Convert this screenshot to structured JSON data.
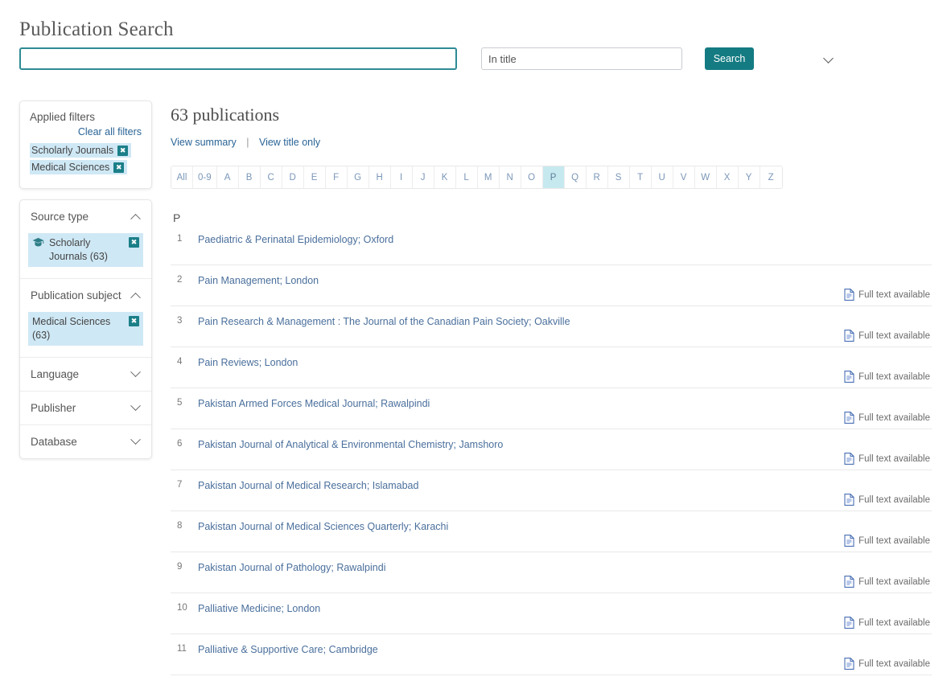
{
  "page": {
    "title": "Publication Search"
  },
  "search": {
    "query_value": "",
    "query_placeholder": "",
    "scope_selected": "In title",
    "scope_options": [
      "In title"
    ],
    "search_button": "Search",
    "dropdown_icon": "chevron-down-icon"
  },
  "applied_filters": {
    "heading": "Applied filters",
    "clear_all": "Clear all filters",
    "chips": [
      {
        "label": "Scholarly Journals",
        "remove_icon": "close-icon"
      },
      {
        "label": "Medical Sciences",
        "remove_icon": "close-icon"
      }
    ]
  },
  "facets": [
    {
      "name": "Source type",
      "expanded": true,
      "toggle_icon": "chevron-up-icon",
      "items": [
        {
          "label": "Scholarly Journals (63)",
          "icon": "graduation-cap-icon",
          "remove_icon": "close-icon"
        }
      ]
    },
    {
      "name": "Publication subject",
      "expanded": true,
      "toggle_icon": "chevron-up-icon",
      "items": [
        {
          "label": "Medical Sciences (63)",
          "icon": "",
          "remove_icon": "close-icon"
        }
      ]
    },
    {
      "name": "Language",
      "expanded": false,
      "toggle_icon": "chevron-down-icon",
      "items": []
    },
    {
      "name": "Publisher",
      "expanded": false,
      "toggle_icon": "chevron-down-icon",
      "items": []
    },
    {
      "name": "Database",
      "expanded": false,
      "toggle_icon": "chevron-down-icon",
      "items": []
    }
  ],
  "results": {
    "count_label": "63 publications",
    "view_summary": "View summary",
    "view_separator": "|",
    "view_title_only": "View title only",
    "alphabet": [
      "All",
      "0-9",
      "A",
      "B",
      "C",
      "D",
      "E",
      "F",
      "G",
      "H",
      "I",
      "J",
      "K",
      "L",
      "M",
      "N",
      "O",
      "P",
      "Q",
      "R",
      "S",
      "T",
      "U",
      "V",
      "W",
      "X",
      "Y",
      "Z"
    ],
    "alphabet_active": "P",
    "group_letter": "P",
    "full_text_label": "Full text available",
    "full_text_icon": "document-icon",
    "items": [
      {
        "num": "1",
        "title": "Paediatric & Perinatal Epidemiology; Oxford",
        "full_text": false
      },
      {
        "num": "2",
        "title": "Pain Management; London",
        "full_text": true
      },
      {
        "num": "3",
        "title": "Pain Research & Management : The Journal of the Canadian Pain Society; Oakville",
        "full_text": true
      },
      {
        "num": "4",
        "title": "Pain Reviews; London",
        "full_text": true
      },
      {
        "num": "5",
        "title": "Pakistan Armed Forces Medical Journal; Rawalpindi",
        "full_text": true
      },
      {
        "num": "6",
        "title": "Pakistan Journal of Analytical & Environmental Chemistry; Jamshoro",
        "full_text": true
      },
      {
        "num": "7",
        "title": "Pakistan Journal of Medical Research; Islamabad",
        "full_text": true
      },
      {
        "num": "8",
        "title": "Pakistan Journal of Medical Sciences Quarterly; Karachi",
        "full_text": true
      },
      {
        "num": "9",
        "title": "Pakistan Journal of Pathology; Rawalpindi",
        "full_text": true
      },
      {
        "num": "10",
        "title": "Palliative Medicine; London",
        "full_text": true
      },
      {
        "num": "11",
        "title": "Palliative & Supportive Care; Cambridge",
        "full_text": true
      }
    ]
  },
  "colors": {
    "teal": "#147b82",
    "chip_bg": "#cfe8f5",
    "link_blue": "#4a6f9c",
    "active_alpha": "#c6e9ef"
  }
}
